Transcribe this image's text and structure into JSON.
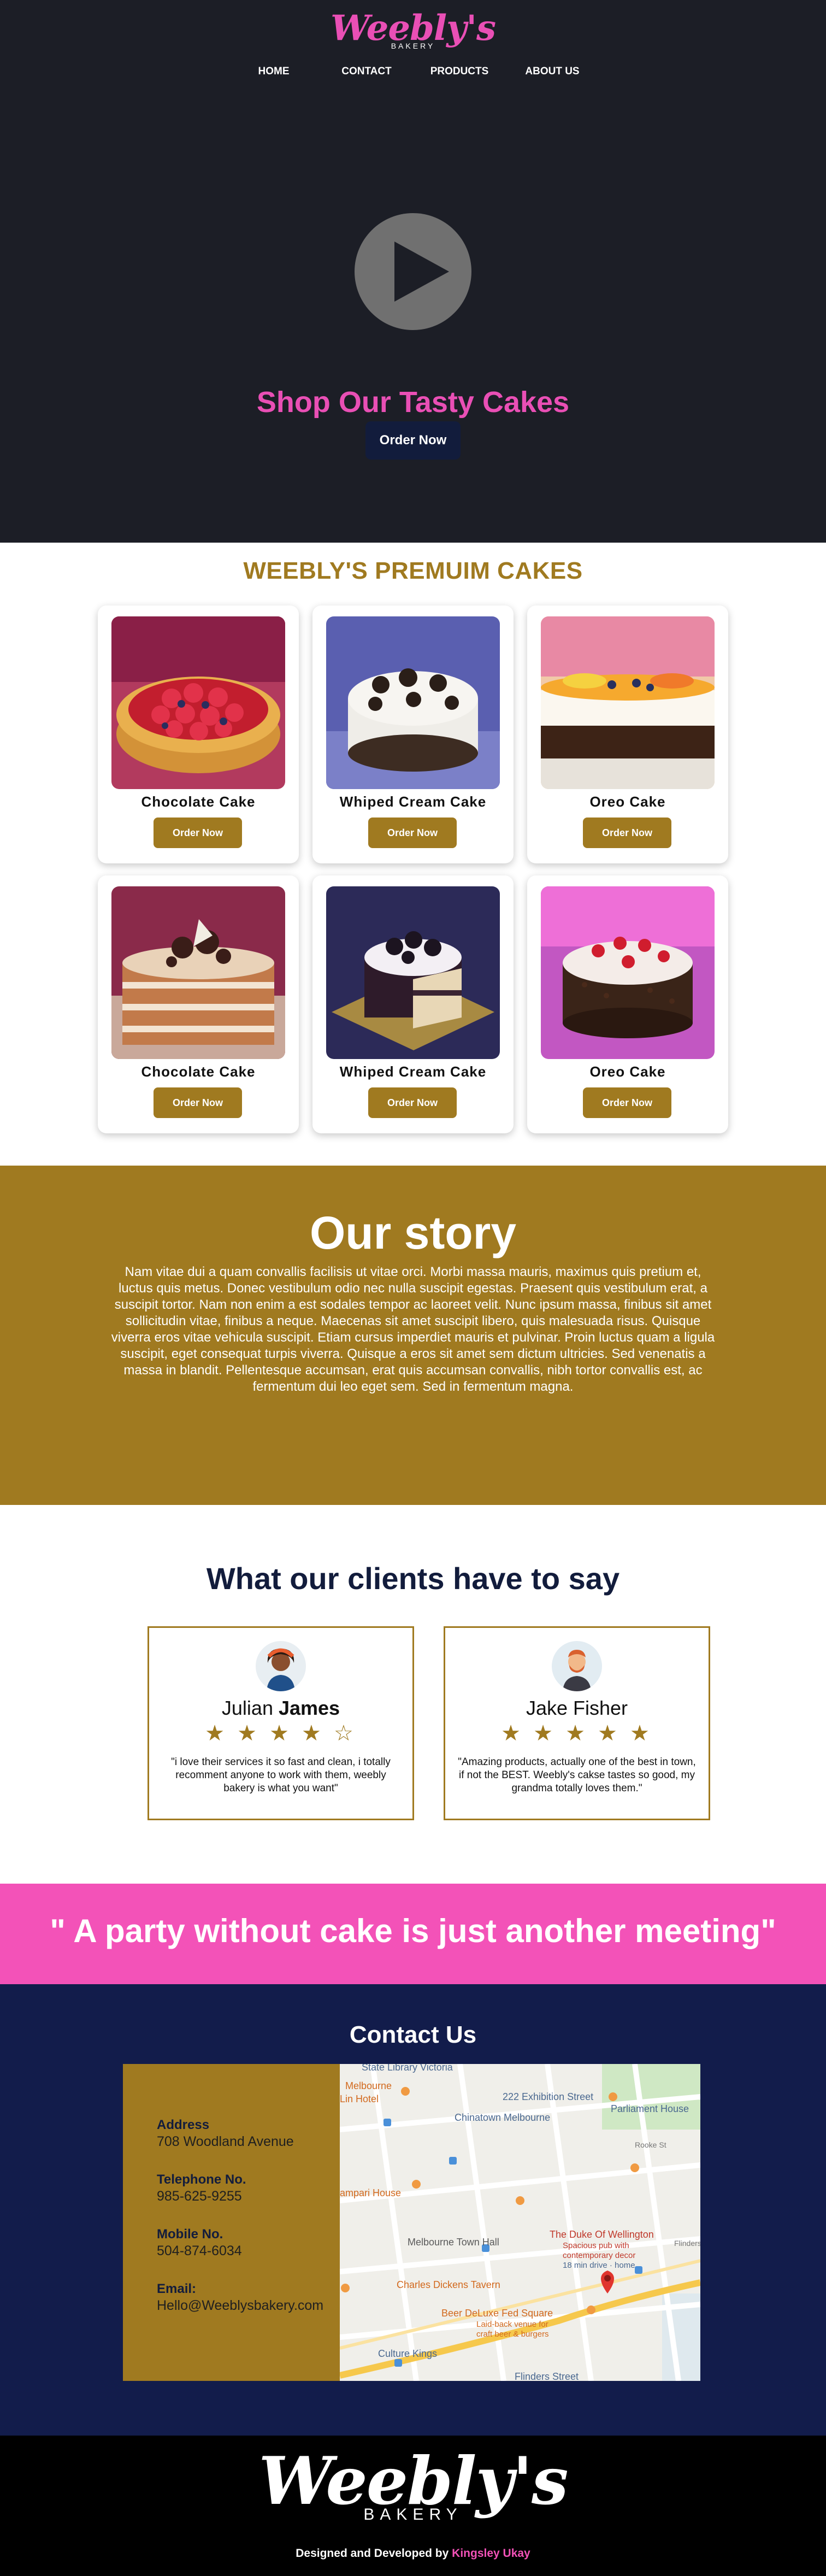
{
  "hero": {
    "logo_script": "Weebly's",
    "logo_sub": "BAKERY",
    "nav": [
      "HOME",
      "CONTACT",
      "PRODUCTS",
      "ABOUT US"
    ],
    "title": "Shop Our Tasty Cakes",
    "button": "Order Now"
  },
  "cakes": {
    "title": "WEEBLY'S PREMUIM CAKES",
    "items": [
      {
        "name": "Chocolate Cake",
        "button": "Order Now"
      },
      {
        "name": "Whiped Cream Cake",
        "button": "Order Now"
      },
      {
        "name": "Oreo Cake",
        "button": "Order Now"
      },
      {
        "name": "Chocolate Cake",
        "button": "Order Now"
      },
      {
        "name": "Whiped Cream Cake",
        "button": "Order Now"
      },
      {
        "name": "Oreo Cake",
        "button": "Order Now"
      }
    ]
  },
  "story": {
    "title": "Our story",
    "text": "Nam vitae dui a quam convallis facilisis ut vitae orci. Morbi massa mauris, maximus quis pretium et, luctus quis metus. Donec vestibulum odio nec nulla suscipit egestas. Praesent quis vestibulum erat, a suscipit tortor. Nam non enim a est sodales tempor ac laoreet velit. Nunc ipsum massa, finibus sit amet sollicitudin vitae, finibus a neque. Maecenas sit amet suscipit libero, quis malesuada risus. Quisque viverra eros vitae vehicula suscipit. Etiam cursus imperdiet mauris et pulvinar. Proin luctus quam a ligula suscipit, eget consequat turpis viverra. Quisque a eros sit amet sem dictum ultricies. Sed venenatis a massa in blandit. Pellentesque accumsan, erat quis accumsan convallis, nibh tortor convallis est, ac fermentum dui leo eget sem. Sed in fermentum magna."
  },
  "testimonials": {
    "title": "What our clients have to say",
    "items": [
      {
        "first": "Julian",
        "last": "James",
        "stars": "★ ★ ★ ★ ☆",
        "rating": 4,
        "quote": "\"i love their services it so fast and clean, i totally recomment anyone to work with them, weebly bakery is what you want\""
      },
      {
        "first": "Jake",
        "last": "Fisher",
        "stars": "★ ★ ★ ★ ★",
        "rating": 5,
        "quote": "\"Amazing products, actually one of the best in town, if not the BEST. Weebly's cakse tastes so good, my grandma totally loves them.\""
      }
    ]
  },
  "banner": {
    "quote": "\" A party without cake is just another meeting\""
  },
  "contact": {
    "title": "Contact Us",
    "address_label": "Address",
    "address_value": "708 Woodland Avenue",
    "phone_label": "Telephone No.",
    "phone_value": "985-625-9255",
    "mobile_label": "Mobile No.",
    "mobile_value": "504-874-6034",
    "email_label": "Email:",
    "email_value": "Hello@Weeblysbakery.com",
    "map_labels": {
      "l1": "State Library Victoria",
      "l2": "Melbourne",
      "l3": "Lin Hotel",
      "l4": "222 Exhibition Street",
      "l5": "Chinatown Melbourne",
      "l6": "Parliament House",
      "l7": "Rooke St",
      "l8": "ampari House",
      "l9": "Melbourne Town Hall",
      "l10": "The Duke Of Wellington",
      "l11": "Spacious pub with",
      "l12": "contemporary decor",
      "l13": "18 min drive · home",
      "l14": "Charles Dickens Tavern",
      "l15": "Beer DeLuxe Fed Square",
      "l16": "Laid-back venue for",
      "l17": "craft beer & burgers",
      "l18": "Culture Kings",
      "l19": "Flinders",
      "l20": "Flinders Street"
    }
  },
  "footer": {
    "logo_script": "Weebly's",
    "logo_sub": "BAKERY",
    "credit_prefix": "Designed and Developed by",
    "credit_name": "Kingsley Ukay"
  }
}
